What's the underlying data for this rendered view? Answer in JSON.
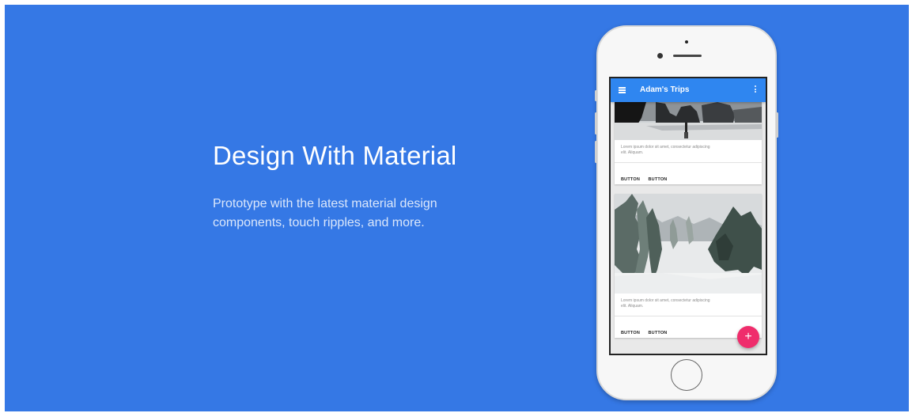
{
  "hero": {
    "title": "Design With Material",
    "subtitle_line1": "Prototype with the latest material design",
    "subtitle_line2": "components, touch ripples, and more."
  },
  "phone": {
    "appbar": {
      "title": "Adam's Trips",
      "menu_icon": "hamburger-menu-icon",
      "more_icon": "more-vert-icon"
    },
    "cards": [
      {
        "text_line1": "Lorem ipsum dolor sit amet, consectetur adipiscing",
        "text_line2": "elit. Aliquam.",
        "buttons": [
          "BUTTON",
          "BUTTON"
        ]
      },
      {
        "text_line1": "Lorem ipsum dolor sit amet, consectetur adipiscing",
        "text_line2": "elit. Aliquam.",
        "buttons": [
          "BUTTON",
          "BUTTON"
        ]
      }
    ],
    "fab_symbol": "+"
  },
  "colors": {
    "background": "#3578e5",
    "appbar": "#2f86f0",
    "fab": "#ef2d6c"
  }
}
